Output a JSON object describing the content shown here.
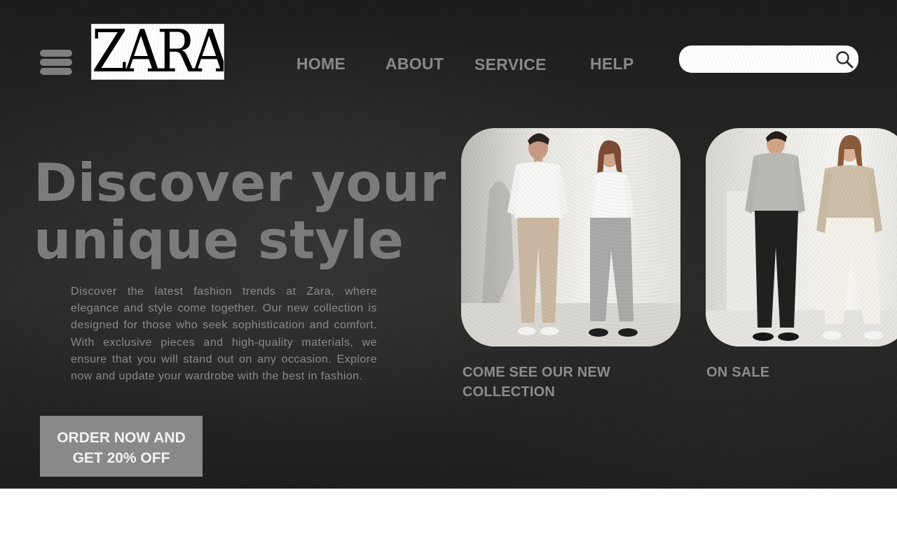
{
  "header": {
    "menu_icon": "hamburger-menu-icon",
    "logo_text": "ZARA",
    "nav": [
      {
        "label": "HOME"
      },
      {
        "label": "ABOUT"
      },
      {
        "label": "SERVICE"
      },
      {
        "label": "HELP"
      }
    ],
    "search": {
      "placeholder": "",
      "value": "",
      "icon": "search-icon"
    }
  },
  "hero": {
    "headline_line1": "Discover your",
    "headline_line2": "unique style",
    "description": "Discover the latest fashion trends at Zara, where elegance and style come together. Our new collection is designed for those who seek sophistication and comfort. With exclusive pieces and high-quality materials, we ensure that you will stand out on any occasion. Explore now and update your wardrobe with the best in fashion.",
    "cta_label": "ORDER NOW AND GET 20% OFF"
  },
  "products": [
    {
      "label": "COME SEE OUR NEW COLLECTION"
    },
    {
      "label": "ON SALE"
    }
  ],
  "colors": {
    "background": "#252525",
    "nav_text": "#8a8a8a",
    "headline": "#7c7c7c",
    "cta_background": "#8a8a8a",
    "page_background": "#ffffff"
  }
}
